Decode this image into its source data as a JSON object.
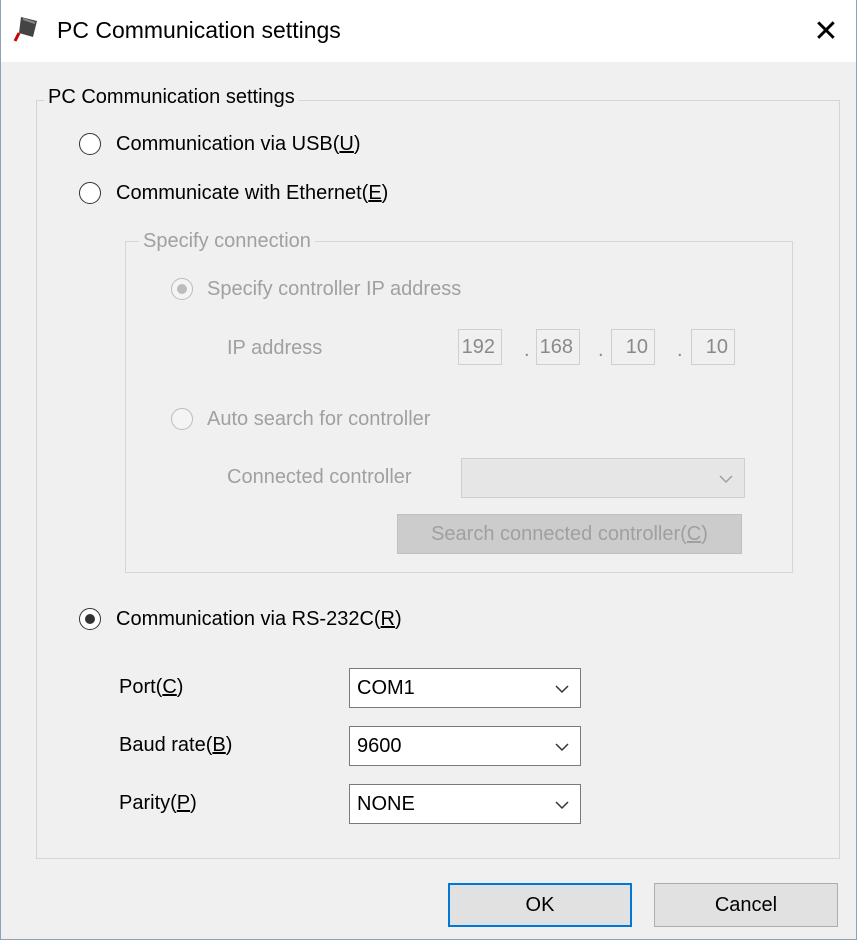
{
  "window": {
    "title": "PC Communication settings",
    "icon": "plug-icon",
    "close_icon": "close-icon"
  },
  "group_title": "PC Communication settings",
  "usb": {
    "label": "Communication via USB(",
    "mnemonic": "U",
    "suffix": ")"
  },
  "ethernet": {
    "label": "Communicate with Ethernet(",
    "mnemonic": "E",
    "suffix": ")"
  },
  "specify": {
    "title": "Specify connection",
    "ip_option": "Specify controller IP address",
    "ip_label": "IP address",
    "ip": [
      "192",
      "168",
      "10",
      "10"
    ],
    "ip_sep": ".",
    "auto_option": "Auto search for controller",
    "connected_label": "Connected controller",
    "connected_value": "",
    "search_button": {
      "label": "Search connected controller(",
      "mnemonic": "C",
      "suffix": ")"
    }
  },
  "rs232": {
    "label": "Communication via RS-232C(",
    "mnemonic": "R",
    "suffix": ")"
  },
  "port": {
    "label": "Port(",
    "mnemonic": "C",
    "suffix": ")",
    "value": "COM1"
  },
  "baud": {
    "label": "Baud rate(",
    "mnemonic": "B",
    "suffix": ")",
    "value": "9600"
  },
  "parity": {
    "label": "Parity(",
    "mnemonic": "P",
    "suffix": ")",
    "value": "NONE"
  },
  "buttons": {
    "ok": "OK",
    "cancel": "Cancel"
  },
  "selected_option": "rs232",
  "colors": {
    "accent": "#0078d7",
    "disabled_text": "#a0a0a0"
  }
}
